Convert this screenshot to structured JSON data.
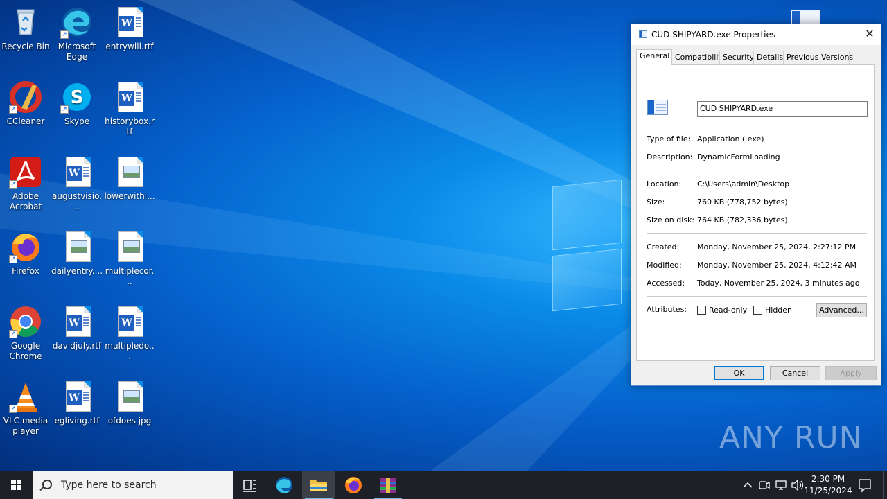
{
  "desktop": {
    "icons": [
      {
        "label": "Recycle Bin",
        "kind": "recycle-bin-icon",
        "shortcut": false
      },
      {
        "label": "Microsoft Edge",
        "kind": "edge-icon",
        "shortcut": true
      },
      {
        "label": "entrywill.rtf",
        "kind": "word-document-icon",
        "shortcut": false
      },
      {
        "label": "CCleaner",
        "kind": "ccleaner-icon",
        "shortcut": true
      },
      {
        "label": "Skype",
        "kind": "skype-icon",
        "shortcut": true
      },
      {
        "label": "historybox.rtf",
        "kind": "word-document-icon",
        "shortcut": false
      },
      {
        "label": "Adobe Acrobat",
        "kind": "acrobat-icon",
        "shortcut": true
      },
      {
        "label": "augustvisio...",
        "kind": "word-document-icon",
        "shortcut": false
      },
      {
        "label": "lowerwithi...",
        "kind": "image-file-icon",
        "shortcut": false
      },
      {
        "label": "Firefox",
        "kind": "firefox-icon",
        "shortcut": true
      },
      {
        "label": "dailyentry....",
        "kind": "image-file-icon",
        "shortcut": false
      },
      {
        "label": "multiplecor...",
        "kind": "image-file-icon",
        "shortcut": false
      },
      {
        "label": "Google Chrome",
        "kind": "chrome-icon",
        "shortcut": true
      },
      {
        "label": "davidjuly.rtf",
        "kind": "word-document-icon",
        "shortcut": false
      },
      {
        "label": "multipledo...",
        "kind": "word-document-icon",
        "shortcut": false
      },
      {
        "label": "VLC media player",
        "kind": "vlc-icon",
        "shortcut": true
      },
      {
        "label": "egliving.rtf",
        "kind": "word-document-icon",
        "shortcut": false
      },
      {
        "label": "ofdoes.jpg",
        "kind": "image-file-icon",
        "shortcut": false
      }
    ]
  },
  "dialog": {
    "title": "CUD SHIPYARD.exe Properties",
    "close_glyph": "✕",
    "tabs": [
      "General",
      "Compatibility",
      "Security",
      "Details",
      "Previous Versions"
    ],
    "active_tab": "General",
    "file_name": "CUD SHIPYARD.exe",
    "type_label": "Type of file:",
    "type_value": "Application (.exe)",
    "description_label": "Description:",
    "description_value": "DynamicFormLoading",
    "location_label": "Location:",
    "location_value": "C:\\Users\\admin\\Desktop",
    "size_label": "Size:",
    "size_value": "760 KB (778,752 bytes)",
    "size_on_disk_label": "Size on disk:",
    "size_on_disk_value": "764 KB (782,336 bytes)",
    "created_label": "Created:",
    "created_value": "Monday, November 25, 2024, 2:27:12 PM",
    "modified_label": "Modified:",
    "modified_value": "Monday, November 25, 2024, 4:12:42 AM",
    "accessed_label": "Accessed:",
    "accessed_value": "Today, November 25, 2024, 3 minutes ago",
    "attributes_label": "Attributes:",
    "readonly_label": "Read-only",
    "readonly_checked": false,
    "hidden_label": "Hidden",
    "hidden_checked": false,
    "advanced_label": "Advanced...",
    "ok_label": "OK",
    "cancel_label": "Cancel",
    "apply_label": "Apply"
  },
  "taskbar": {
    "search_placeholder": "Type here to search",
    "pinned": [
      "task-view-icon",
      "edge-icon",
      "file-explorer-icon",
      "firefox-icon",
      "winrar-icon"
    ],
    "active_app": "file-explorer-icon",
    "clock_time": "2:30 PM",
    "clock_date": "11/25/2024"
  },
  "watermark": "ANY RUN",
  "colors": {
    "accent": "#0078d7",
    "taskbar": "#1d2027",
    "wallpaper": "#0a8ae8"
  }
}
